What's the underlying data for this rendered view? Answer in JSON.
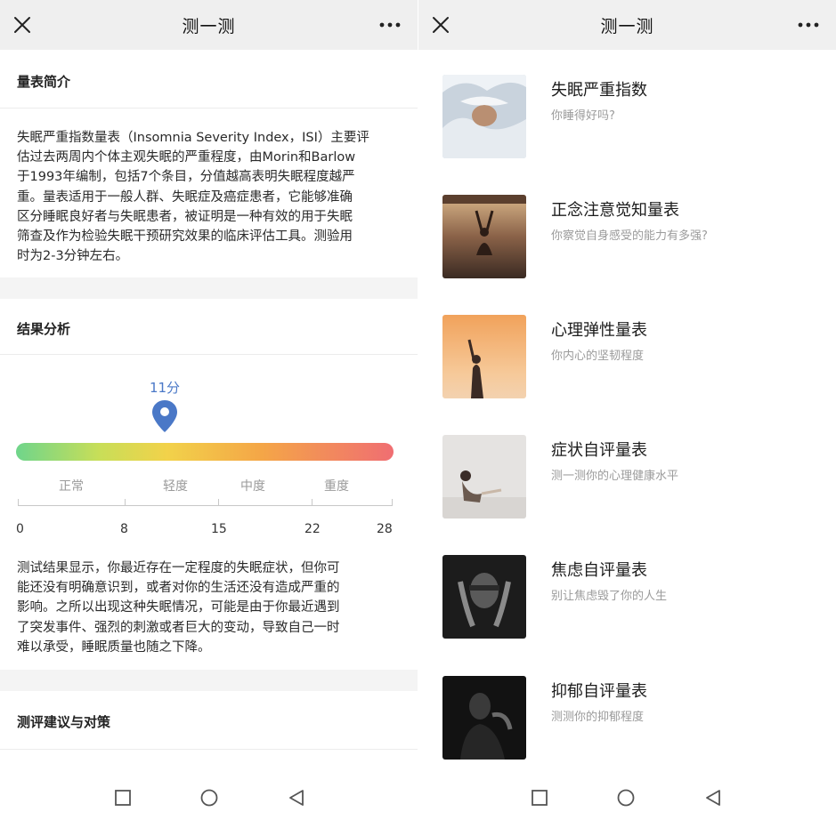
{
  "left": {
    "title": "测一测",
    "sections": {
      "intro_heading": "量表简介",
      "intro_lines": [
        "失眠严重指数量表（Insomnia Severity Index，ISI）主要评",
        "估过去两周内个体主观失眠的严重程度，由Morin和Barlow",
        "于1993年编制，包括7个条目，分值越高表明失眠程度越严",
        "重。量表适用于一般人群、失眠症及癌症患者，它能够准确",
        "区分睡眠良好者与失眠患者，被证明是一种有效的用于失眠",
        "筛查及作为检验失眠干预研究效果的临床评估工具。测验用",
        "时为2-3分钟左右。"
      ],
      "result_heading": "结果分析",
      "score_label": "11分",
      "score_value": 11,
      "scale_max": 28,
      "levels": [
        "正常",
        "轻度",
        "中度",
        "重度"
      ],
      "ticks": [
        "0",
        "8",
        "15",
        "22",
        "28"
      ],
      "result_lines": [
        "测试结果显示，你最近存在一定程度的失眠症状，但你可",
        "能还没有明确意识到，或者对你的生活还没有造成严重的",
        "影响。之所以出现这种失眠情况，可能是由于你最近遇到",
        "了突发事件、强烈的刺激或者巨大的变动，导致自己一时",
        "难以承受，睡眠质量也随之下降。"
      ],
      "advice_heading": "测评建议与对策"
    }
  },
  "right": {
    "title": "测一测",
    "items": [
      {
        "title": "失眠严重指数",
        "subtitle": "你睡得好吗?"
      },
      {
        "title": "正念注意觉知量表",
        "subtitle": "你察觉自身感受的能力有多强?"
      },
      {
        "title": "心理弹性量表",
        "subtitle": "你内心的坚韧程度"
      },
      {
        "title": "症状自评量表",
        "subtitle": "测一测你的心理健康水平"
      },
      {
        "title": "焦虑自评量表",
        "subtitle": "别让焦虑毁了你的人生"
      },
      {
        "title": "抑郁自评量表",
        "subtitle": "测测你的抑郁程度"
      }
    ]
  },
  "colors": {
    "accent": "#4a78c7",
    "topbar_bg": "#efefef",
    "gradient": [
      "#6fd58b",
      "#f2d24a",
      "#f06e72"
    ]
  },
  "icons": {
    "close": "close-icon",
    "more": "more-icon",
    "pin": "location-pin-icon",
    "nav": [
      "square-icon",
      "circle-icon",
      "back-triangle-icon"
    ]
  }
}
